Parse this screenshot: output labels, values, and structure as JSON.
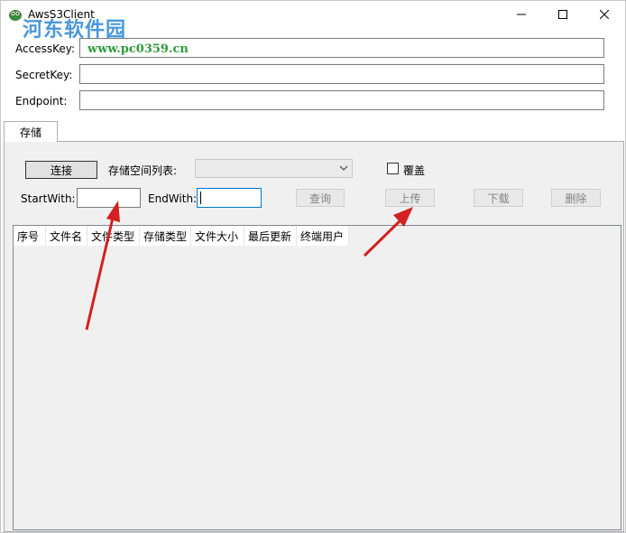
{
  "window": {
    "title": "AwsS3Client",
    "controls": {
      "minimize": "minimize",
      "maximize": "maximize",
      "close": "close"
    }
  },
  "watermark": {
    "text": "河东软件园",
    "url": "www.pc0359.cn"
  },
  "credentials": {
    "access_key_label": "AccessKey:",
    "access_key_value": "",
    "secret_key_label": "SecretKey:",
    "secret_key_value": "",
    "endpoint_label": "Endpoint:",
    "endpoint_value": ""
  },
  "tabs": [
    {
      "label": "存储",
      "selected": true
    }
  ],
  "storage": {
    "connect_button": "连接",
    "bucket_list_label": "存储空间列表:",
    "bucket_selected": "",
    "overwrite_label": "覆盖",
    "overwrite_checked": false,
    "start_with_label": "StartWith:",
    "start_with_value": "",
    "end_with_label": "EndWith:",
    "end_with_value": "",
    "query_button": "查询",
    "upload_button": "上传",
    "download_button": "下载",
    "delete_button": "删除"
  },
  "list": {
    "columns": [
      "序号",
      "文件名",
      "文件类型",
      "存储类型",
      "文件大小",
      "最后更新",
      "终端用户"
    ],
    "rows": []
  },
  "colors": {
    "annotation_arrow": "#d42020",
    "watermark_blue": "#3a8fd8",
    "watermark_green": "#2e9a3a"
  }
}
